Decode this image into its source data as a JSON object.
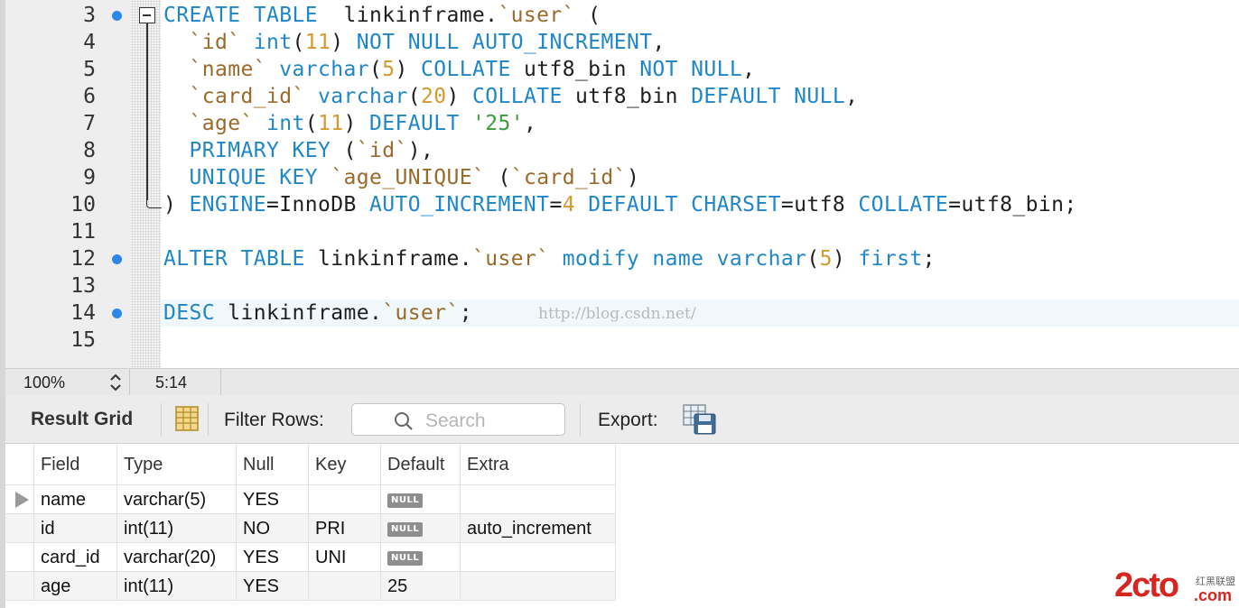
{
  "editor": {
    "lines": [
      {
        "num": "3",
        "marker": true,
        "tokens": [
          [
            "kw",
            "CREATE TABLE"
          ],
          [
            "",
            "  linkinframe."
          ],
          [
            "bt",
            "`user`"
          ],
          [
            "",
            " ("
          ]
        ]
      },
      {
        "num": "4",
        "marker": false,
        "tokens": [
          [
            "",
            "  "
          ],
          [
            "bt",
            "`id`"
          ],
          [
            "",
            " "
          ],
          [
            "kw",
            "int"
          ],
          [
            "",
            "("
          ],
          [
            "num",
            "11"
          ],
          [
            "",
            ") "
          ],
          [
            "kw",
            "NOT NULL AUTO_INCREMENT"
          ],
          [
            "",
            ","
          ]
        ]
      },
      {
        "num": "5",
        "marker": false,
        "tokens": [
          [
            "",
            "  "
          ],
          [
            "bt",
            "`name`"
          ],
          [
            "",
            " "
          ],
          [
            "kw",
            "varchar"
          ],
          [
            "",
            "("
          ],
          [
            "num",
            "5"
          ],
          [
            "",
            ") "
          ],
          [
            "kw",
            "COLLATE"
          ],
          [
            "",
            " utf8_bin "
          ],
          [
            "kw",
            "NOT NULL"
          ],
          [
            "",
            ","
          ]
        ]
      },
      {
        "num": "6",
        "marker": false,
        "tokens": [
          [
            "",
            "  "
          ],
          [
            "bt",
            "`card_id`"
          ],
          [
            "",
            " "
          ],
          [
            "kw",
            "varchar"
          ],
          [
            "",
            "("
          ],
          [
            "num",
            "20"
          ],
          [
            "",
            ") "
          ],
          [
            "kw",
            "COLLATE"
          ],
          [
            "",
            " utf8_bin "
          ],
          [
            "kw",
            "DEFAULT NULL"
          ],
          [
            "",
            ","
          ]
        ]
      },
      {
        "num": "7",
        "marker": false,
        "tokens": [
          [
            "",
            "  "
          ],
          [
            "bt",
            "`age`"
          ],
          [
            "",
            " "
          ],
          [
            "kw",
            "int"
          ],
          [
            "",
            "("
          ],
          [
            "num",
            "11"
          ],
          [
            "",
            ") "
          ],
          [
            "kw",
            "DEFAULT"
          ],
          [
            "",
            " "
          ],
          [
            "str",
            "'25'"
          ],
          [
            "",
            ","
          ]
        ]
      },
      {
        "num": "8",
        "marker": false,
        "tokens": [
          [
            "",
            "  "
          ],
          [
            "kw",
            "PRIMARY KEY"
          ],
          [
            "",
            " ("
          ],
          [
            "bt",
            "`id`"
          ],
          [
            "",
            "),"
          ]
        ]
      },
      {
        "num": "9",
        "marker": false,
        "tokens": [
          [
            "",
            "  "
          ],
          [
            "kw",
            "UNIQUE KEY"
          ],
          [
            "",
            " "
          ],
          [
            "bt",
            "`age_UNIQUE`"
          ],
          [
            "",
            " ("
          ],
          [
            "bt",
            "`card_id`"
          ],
          [
            "",
            ")"
          ]
        ]
      },
      {
        "num": "10",
        "marker": false,
        "tokens": [
          [
            "",
            ") "
          ],
          [
            "kw",
            "ENGINE"
          ],
          [
            "",
            "=InnoDB "
          ],
          [
            "kw",
            "AUTO_INCREMENT"
          ],
          [
            "",
            "="
          ],
          [
            "num",
            "4"
          ],
          [
            "",
            " "
          ],
          [
            "kw",
            "DEFAULT CHARSET"
          ],
          [
            "",
            "=utf8 "
          ],
          [
            "kw",
            "COLLATE"
          ],
          [
            "",
            "=utf8_bin;"
          ]
        ]
      },
      {
        "num": "11",
        "marker": false,
        "tokens": []
      },
      {
        "num": "12",
        "marker": true,
        "tokens": [
          [
            "kw",
            "ALTER TABLE"
          ],
          [
            "",
            " linkinframe."
          ],
          [
            "bt",
            "`user`"
          ],
          [
            "",
            " "
          ],
          [
            "kw",
            "modify"
          ],
          [
            "",
            " "
          ],
          [
            "kw",
            "name"
          ],
          [
            "",
            " "
          ],
          [
            "kw",
            "varchar"
          ],
          [
            "",
            "("
          ],
          [
            "num",
            "5"
          ],
          [
            "",
            ") "
          ],
          [
            "kw",
            "first"
          ],
          [
            "",
            ";"
          ]
        ]
      },
      {
        "num": "13",
        "marker": false,
        "tokens": []
      },
      {
        "num": "14",
        "marker": true,
        "tokens": [
          [
            "kw",
            "DESC"
          ],
          [
            "",
            " linkinframe."
          ],
          [
            "bt",
            "`user`"
          ],
          [
            "",
            ";"
          ]
        ]
      },
      {
        "num": "15",
        "marker": false,
        "tokens": []
      }
    ],
    "watermark": "http://blog.csdn.net/"
  },
  "status": {
    "zoom": "100%",
    "cursor": "5:14"
  },
  "toolbar": {
    "title": "Result Grid",
    "filter_label": "Filter Rows:",
    "search_placeholder": "Search",
    "export_label": "Export:"
  },
  "grid": {
    "columns": [
      "Field",
      "Type",
      "Null",
      "Key",
      "Default",
      "Extra"
    ],
    "rows": [
      {
        "field": "name",
        "type": "varchar(5)",
        "null": "YES",
        "key": "",
        "default": "NULL",
        "default_is_null": true,
        "extra": ""
      },
      {
        "field": "id",
        "type": "int(11)",
        "null": "NO",
        "key": "PRI",
        "default": "NULL",
        "default_is_null": true,
        "extra": "auto_increment"
      },
      {
        "field": "card_id",
        "type": "varchar(20)",
        "null": "YES",
        "key": "UNI",
        "default": "NULL",
        "default_is_null": true,
        "extra": ""
      },
      {
        "field": "age",
        "type": "int(11)",
        "null": "YES",
        "key": "",
        "default": "25",
        "default_is_null": false,
        "extra": ""
      }
    ]
  },
  "logo": {
    "text": "2cto",
    "sub": "红黑联盟",
    "domain": ".com"
  },
  "colors": {
    "keyword": "#1f87c8",
    "backtick": "#9a6a2a",
    "number": "#d39a2e",
    "string": "#3e9b3e",
    "marker": "#2d87e6"
  }
}
